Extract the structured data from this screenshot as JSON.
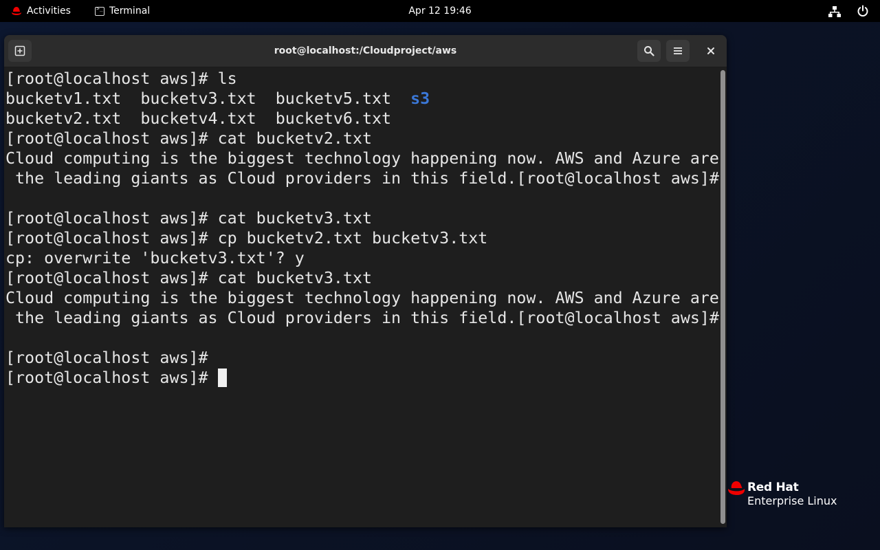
{
  "topbar": {
    "activities_label": "Activities",
    "app_label": "Terminal",
    "clock": "Apr 12  19:46"
  },
  "window": {
    "title": "root@localhost:/Cloudproject/aws"
  },
  "terminal": {
    "lines": [
      "[root@localhost aws]# ls",
      "bucketv1.txt  bucketv3.txt  bucketv5.txt  ",
      "bucketv2.txt  bucketv4.txt  bucketv6.txt",
      "[root@localhost aws]# cat bucketv2.txt",
      "Cloud computing is the biggest technology happening now. AWS and Azure are",
      " the leading giants as Cloud providers in this field.[root@localhost aws]#",
      "",
      "[root@localhost aws]# cat bucketv3.txt",
      "[root@localhost aws]# cp bucketv2.txt bucketv3.txt",
      "cp: overwrite 'bucketv3.txt'? y",
      "[root@localhost aws]# cat bucketv3.txt",
      "Cloud computing is the biggest technology happening now. AWS and Azure are",
      " the leading giants as Cloud providers in this field.[root@localhost aws]#",
      "",
      "[root@localhost aws]#",
      "[root@localhost aws]# "
    ],
    "dir_entry": "s3",
    "colors": {
      "directory": "#3b78d8",
      "foreground": "#e6e6e6",
      "background": "#1e1e1e"
    }
  },
  "branding": {
    "line1": "Red Hat",
    "line2": "Enterprise Linux",
    "color": "#ee0000"
  },
  "icons": [
    "redhat-icon",
    "terminal-icon",
    "network-icon",
    "power-icon",
    "new-tab-icon",
    "search-icon",
    "hamburger-menu-icon",
    "close-icon"
  ]
}
